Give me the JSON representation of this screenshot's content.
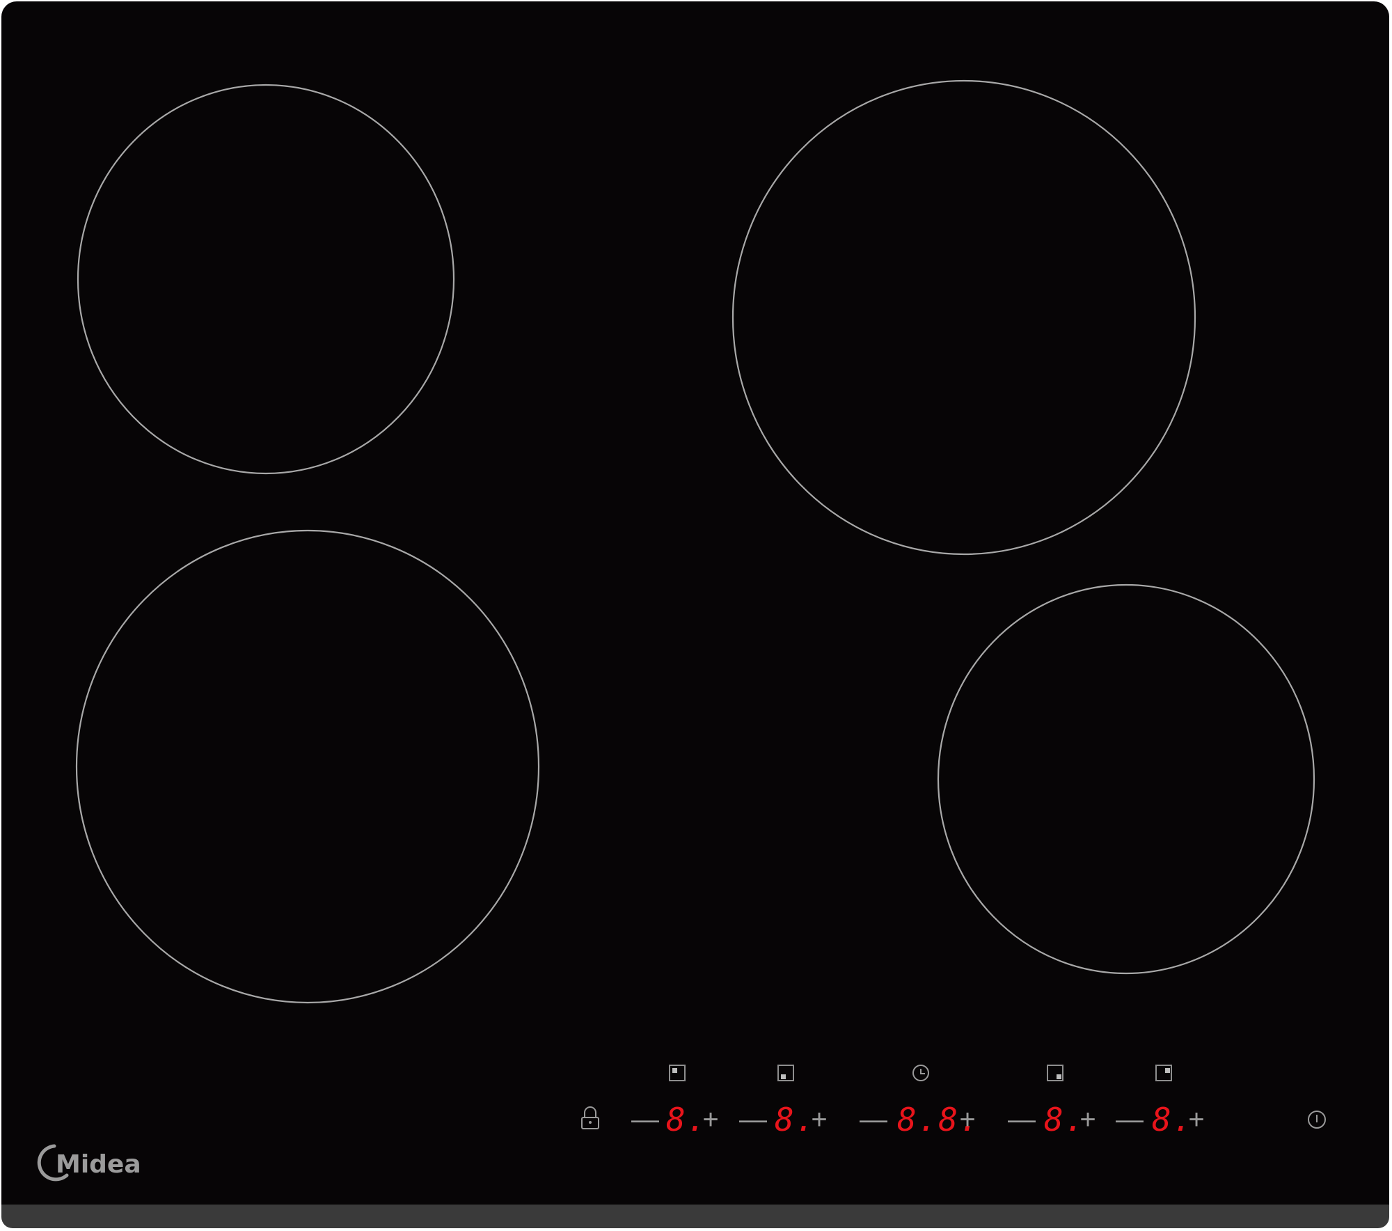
{
  "brand": {
    "logo_text": "Midea"
  },
  "controls": {
    "minus_symbol": "—",
    "plus_symbol": "+",
    "zones": [
      {
        "id": "rear-left",
        "display": "8."
      },
      {
        "id": "front-left",
        "display": "8."
      },
      {
        "id": "front-right",
        "display": "8."
      },
      {
        "id": "rear-right",
        "display": "8."
      }
    ],
    "timer": {
      "display": "8.8."
    }
  },
  "icons": {
    "lock": "lock-icon",
    "timer": "clock-icon",
    "power": "power-icon"
  },
  "colors": {
    "glass": "#070506",
    "display_red": "#e8141b",
    "ring": "#a8a8a8",
    "trim": "#3a3a3a"
  }
}
